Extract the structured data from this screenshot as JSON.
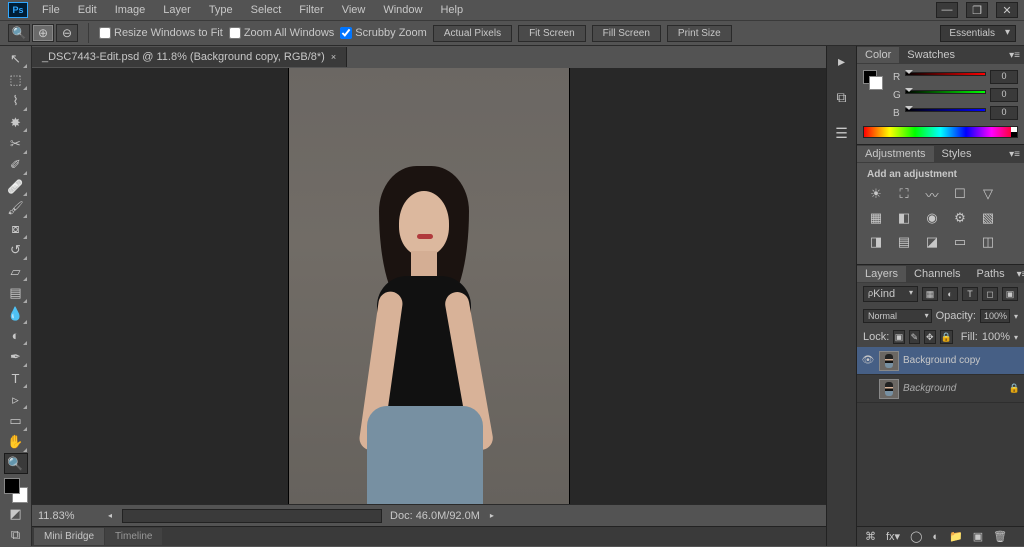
{
  "window": {
    "title": "Ps"
  },
  "menu": [
    "File",
    "Edit",
    "Image",
    "Layer",
    "Type",
    "Select",
    "Filter",
    "View",
    "Window",
    "Help"
  ],
  "workspace": "Essentials",
  "options_bar": {
    "resize_windows": "Resize Windows to Fit",
    "zoom_all": "Zoom All Windows",
    "scrubby": "Scrubby Zoom",
    "buttons": [
      "Actual Pixels",
      "Fit Screen",
      "Fill Screen",
      "Print Size"
    ]
  },
  "doc": {
    "tab": "_DSC7443-Edit.psd @ 11.8% (Background copy, RGB/8*)",
    "zoom": "11.83%",
    "doc_size": "Doc: 46.0M/92.0M"
  },
  "color": {
    "r": "0",
    "g": "0",
    "b": "0",
    "labels": {
      "r": "R",
      "g": "G",
      "b": "B"
    }
  },
  "panels": {
    "color_tab": "Color",
    "swatches_tab": "Swatches",
    "adj_tab": "Adjustments",
    "styles_tab": "Styles",
    "adj_heading": "Add an adjustment",
    "layers_tab": "Layers",
    "channels_tab": "Channels",
    "paths_tab": "Paths"
  },
  "layers": {
    "filter_kind": "Kind",
    "blend_mode": "Normal",
    "opacity_label": "Opacity:",
    "opacity": "100%",
    "lock_label": "Lock:",
    "fill_label": "Fill:",
    "fill": "100%",
    "items": [
      {
        "name": "Background copy",
        "visible": true,
        "locked": false,
        "italic": false
      },
      {
        "name": "Background",
        "visible": false,
        "locked": true,
        "italic": true
      }
    ]
  },
  "bottom_tabs": [
    "Mini Bridge",
    "Timeline"
  ]
}
